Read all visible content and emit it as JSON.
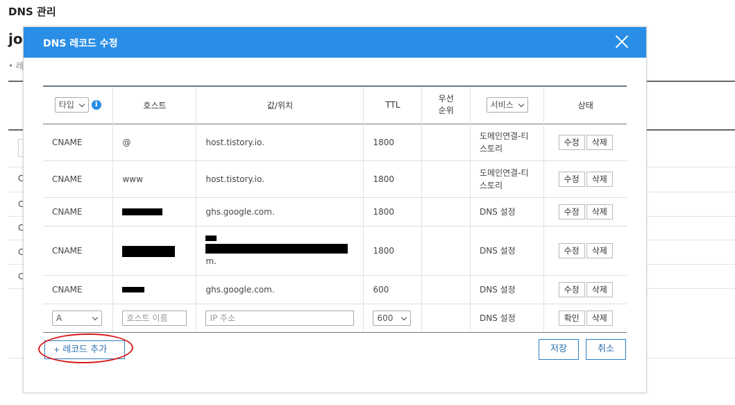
{
  "page": {
    "title": "DNS 관리",
    "domain_prefix": "jo",
    "bullet": "• 레",
    "bg_rows": [
      "C",
      "C",
      "C",
      "C",
      "C"
    ]
  },
  "modal": {
    "title": "DNS 레코드 수정",
    "close_icon": "close-icon",
    "columns": {
      "type": "타입",
      "host": "호스트",
      "value": "값/위치",
      "ttl": "TTL",
      "priority": "우선\n순위",
      "service": "서비스",
      "status": "상태"
    },
    "rows": [
      {
        "type": "CNAME",
        "host": "@",
        "value": "host.tistory.io.",
        "ttl": "1800",
        "priority": "",
        "service": "도메인연결-티\n스토리",
        "edit": "수정",
        "delete": "삭제"
      },
      {
        "type": "CNAME",
        "host": "www",
        "value": "host.tistory.io.",
        "ttl": "1800",
        "priority": "",
        "service": "도메인연결-티\n스토리",
        "edit": "수정",
        "delete": "삭제"
      },
      {
        "type": "CNAME",
        "host": "",
        "value": "ghs.google.com.",
        "ttl": "1800",
        "priority": "",
        "service": "DNS 설정",
        "edit": "수정",
        "delete": "삭제"
      },
      {
        "type": "CNAME",
        "host": "",
        "value": "m.",
        "ttl": "1800",
        "priority": "",
        "service": "DNS 설정",
        "edit": "수정",
        "delete": "삭제"
      },
      {
        "type": "CNAME",
        "host": "",
        "value": "ghs.google.com.",
        "ttl": "600",
        "priority": "",
        "service": "DNS 설정",
        "edit": "수정",
        "delete": "삭제"
      }
    ],
    "new_row": {
      "type_value": "A",
      "host_placeholder": "호스트 이름",
      "value_placeholder": "IP 주소",
      "ttl_value": "600",
      "service": "DNS 설정",
      "confirm": "확인",
      "delete": "삭제"
    },
    "add_record": "+ 레코드 추가",
    "add_record_label": "레코드 추가",
    "save": "저장",
    "cancel": "취소"
  },
  "colors": {
    "header_blue": "#2a8ee6",
    "button_border": "#2a7fc4",
    "annotation_red": "#d81b1b"
  }
}
